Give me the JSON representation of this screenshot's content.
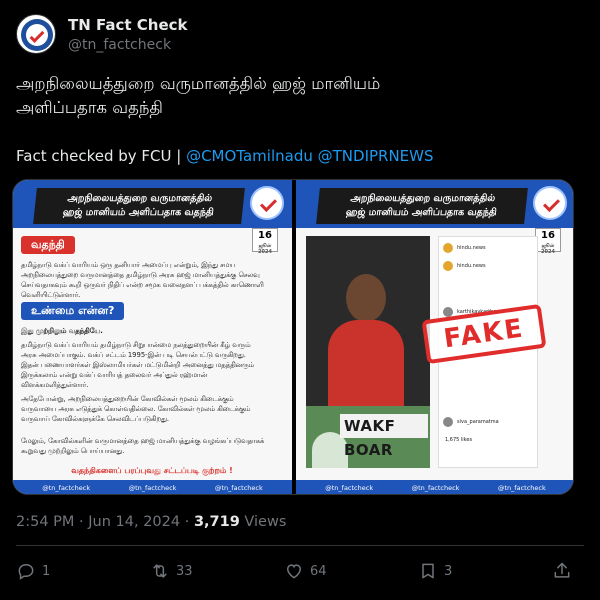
{
  "author": {
    "display_name": "TN Fact Check",
    "handle": "@tn_factcheck"
  },
  "tweet": {
    "text_line1": "அறநிலையத்துறை வருமானத்தில் ஹஜ் மானியம்",
    "text_line2": "அளிப்பதாக வதந்தி",
    "fact_prefix": "Fact checked by FCU | ",
    "mention1": "@CMOTamilnadu",
    "mention2": "@TNDIPRNEWS"
  },
  "media": {
    "left_card": {
      "banner_line1": "அறநிலையத்துறை வருமானத்தில்",
      "banner_line2": "ஹஜ் மானியம் அளிப்பதாக வதந்தி",
      "calendar_day": "16",
      "calendar_label": "ஜூன் 2024",
      "rumor_tag": "வதந்தி",
      "rumor_text": "தமிழ்நாடு வக்ப் வாரியம் ஒரு தனியார் அமைப்பு என்றும், இந்து சமய அறநிலையத்துறை வருமானத்தை தமிழ்நாடு அரசு ஹஜ் மானியத்துக்கு செலவு செய்வதாகவும் கூறி ஒருவர் நிதிப் என்ற சமூக வலைதளப் பக்கத்தில் காணொளி வெளியிட்டுள்ளார்.",
      "truth_tag": "உண்மை என்ன?",
      "truth_lead": "இது முற்றிலும் வதந்தியே.",
      "truth_text": "தமிழ்நாடு வக்ப் வாரியம் தமிழ்நாடு சிறுபான்மை நலத்துறையின் கீழ் வரும் அரசு அமைப்பாகும். வக்ப் சட்டம் 1995-இன் படி செயல்பட்டு வருகிறது. இதன் பணையாளர்கள் இஸ்லாமியர்கள் மட்டுமின்றி அனைத்து மதத்தினரும் இருக்கலாம் என்று வக்ப் வாரியத் தலைவர் அப்துல் ரஹ்மான் விளக்கமளித்துள்ளார்.",
      "temple_text": "அதேபோன்று, அறநிலையத்துறையின் கோவில்கள் மூலம் கிடைக்கும் வருவாயை அரசு எடுத்துக் கொள்வதில்லை. கோவில்கள் மூலம் கிடைக்கும் வருவாய் கோவில்களுக்கே செலவிடப்படுகிறது.",
      "hajj_text": "மேலும், கோவில்களின் வருமானத்தை ஹஜ் மானியத்துக்கு வழங்கப்படுவதாகக் கூறுவது முற்றிலும் பொய்யானது.",
      "slogan": "வதந்திகளைப் பரப்புவது சட்டப்படி குற்றம் !",
      "footer": [
        "@tn_factcheck",
        "@tn_factcheck",
        "@tn_factcheck"
      ]
    },
    "right_card": {
      "banner_line1": "அறநிலையத்துறை வருமானத்தில்",
      "banner_line2": "ஹஜ் மானியம் அளிப்பதாக வதந்தி",
      "calendar_day": "16",
      "calendar_label": "ஜூன் 2024",
      "wakf_sign": "WAKF BOAR",
      "stamp": "FAKE",
      "phone_user1": "hindu.news",
      "phone_user2": "hindu.news",
      "phone_user3": "karthikavkartho",
      "phone_user4": "siva_paramatma",
      "phone_likes": "1,675 likes",
      "footer": [
        "@tn_factcheck",
        "@tn_factcheck",
        "@tn_factcheck"
      ]
    }
  },
  "meta": {
    "time": "2:54 PM",
    "sep1": " · ",
    "date": "Jun 14, 2024",
    "sep2": " · ",
    "views_count": "3,719",
    "views_label": " Views"
  },
  "actions": {
    "replies": "1",
    "reposts": "33",
    "likes": "64",
    "bookmarks": "3"
  },
  "icons": {
    "reply": "reply-icon",
    "repost": "repost-icon",
    "like": "heart-icon",
    "bookmark": "bookmark-icon",
    "share": "share-icon"
  },
  "colors": {
    "background": "#000000",
    "text": "#e7e9ea",
    "muted": "#71767b",
    "link": "#1d9bf0",
    "card_blue": "#1f54b8",
    "rumor_red": "#d9312b"
  }
}
